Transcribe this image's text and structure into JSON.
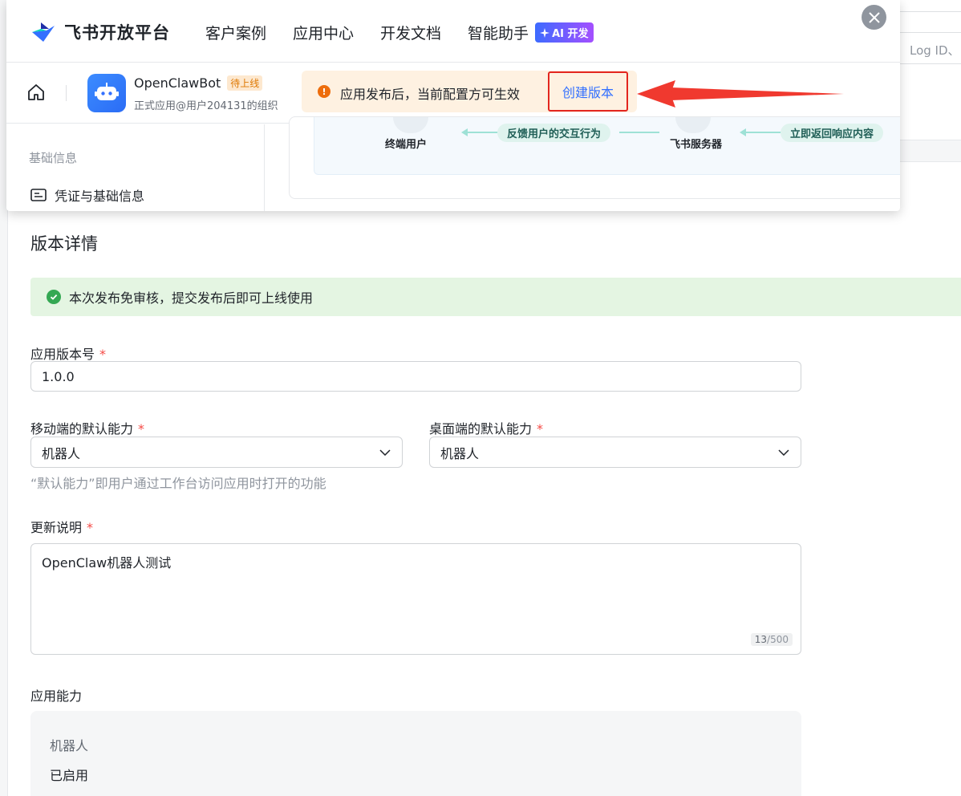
{
  "background": {
    "search_placeholder": "Log ID、"
  },
  "nav": {
    "brand": "飞书开放平台",
    "links": [
      "客户案例",
      "应用中心",
      "开发文档",
      "智能助手"
    ],
    "ai_badge": "AI 开发"
  },
  "app": {
    "name": "OpenClawBot",
    "status": "待上线",
    "org": "正式应用@用户204131的组织"
  },
  "notice": {
    "text": "应用发布后，当前配置方可生效",
    "action": "创建版本"
  },
  "sidebar": {
    "section": "基础信息",
    "item": "凭证与基础信息"
  },
  "diagram": {
    "node_user": "终端用户",
    "node_server": "飞书服务器",
    "pill_feedback": "反馈用户的交互行为",
    "pill_response": "立即返回响应内容"
  },
  "form": {
    "title": "版本详情",
    "success_msg": "本次发布免审核，提交发布后即可上线使用",
    "version_label": "应用版本号",
    "version_value": "1.0.0",
    "mobile_label": "移动端的默认能力",
    "mobile_value": "机器人",
    "desktop_label": "桌面端的默认能力",
    "desktop_value": "机器人",
    "default_hint": "“默认能力”即用户通过工作台访问应用时打开的功能",
    "notes_label": "更新说明",
    "notes_value": "OpenClaw机器人测试",
    "notes_count": "13",
    "notes_max": "/500",
    "capability_label": "应用能力",
    "capability_name": "机器人",
    "capability_state": "已启用",
    "required_mark": "*"
  },
  "colors": {
    "accent": "#3370ff",
    "required": "#f54a45",
    "highlight_border": "#e3261f",
    "success_bg": "#e4f5e2"
  }
}
